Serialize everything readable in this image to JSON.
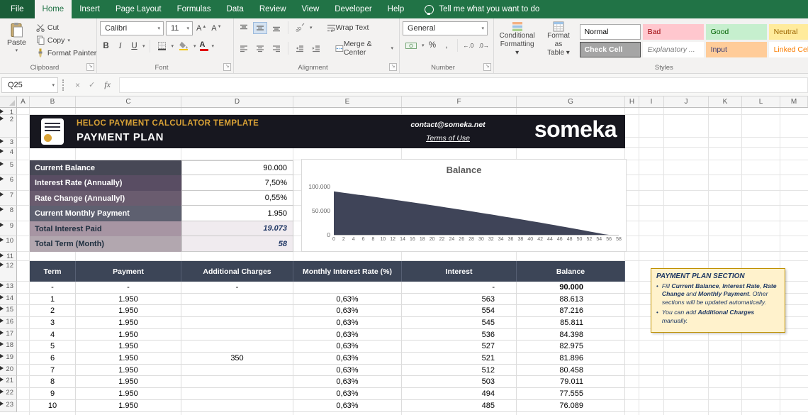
{
  "ribbon": {
    "tabs": [
      {
        "label": "File",
        "active": false
      },
      {
        "label": "Home",
        "active": true
      },
      {
        "label": "Insert",
        "active": false
      },
      {
        "label": "Page Layout",
        "active": false
      },
      {
        "label": "Formulas",
        "active": false
      },
      {
        "label": "Data",
        "active": false
      },
      {
        "label": "Review",
        "active": false
      },
      {
        "label": "View",
        "active": false
      },
      {
        "label": "Developer",
        "active": false
      },
      {
        "label": "Help",
        "active": false
      }
    ],
    "tell_me": "Tell me what you want to do",
    "groups": {
      "clipboard": {
        "label": "Clipboard",
        "paste": "Paste",
        "cut": "Cut",
        "copy": "Copy",
        "format_painter": "Format Painter"
      },
      "font": {
        "label": "Font",
        "family": "Calibri",
        "size": "11",
        "bold": "B",
        "italic": "I",
        "underline": "U"
      },
      "alignment": {
        "label": "Alignment",
        "wrap_text": "Wrap Text",
        "merge_center": "Merge & Center"
      },
      "number": {
        "label": "Number",
        "format": "General"
      },
      "styles": {
        "label": "Styles",
        "conditional_1": "Conditional",
        "conditional_2": "Formatting ▾",
        "format_1": "Format as",
        "format_2": "Table ▾",
        "gallery": [
          {
            "label": "Normal",
            "bg": "#FFFFFF",
            "color": "#000000",
            "border": "#ABABAB"
          },
          {
            "label": "Bad",
            "bg": "#FFC7CE",
            "color": "#9C0006"
          },
          {
            "label": "Good",
            "bg": "#C6EFCE",
            "color": "#006100"
          },
          {
            "label": "Neutral",
            "bg": "#FFEB9C",
            "color": "#9C6500"
          },
          {
            "label": "Check Cell",
            "bg": "#A5A5A5",
            "color": "#FFFFFF",
            "bold": true,
            "border": "#4D4D4D"
          },
          {
            "label": "Explanatory ...",
            "bg": "#FFFFFF",
            "color": "#7F7F7F",
            "italic": true
          },
          {
            "label": "Input",
            "bg": "#FFCC99",
            "color": "#3F3F76"
          },
          {
            "label": "Linked Cell",
            "bg": "#FFFFFF",
            "color": "#FA7D00"
          }
        ]
      }
    }
  },
  "formula_bar": {
    "name_box": "Q25",
    "cancel": "×",
    "enter": "✓",
    "fx": "fx"
  },
  "grid": {
    "col_letters": [
      "A",
      "B",
      "C",
      "D",
      "E",
      "F",
      "G",
      "H",
      "I",
      "J",
      "K",
      "L",
      "M"
    ],
    "row_numbers": [
      1,
      2,
      3,
      4,
      5,
      6,
      7,
      8,
      9,
      10,
      11,
      12,
      13,
      14,
      15,
      16,
      17,
      18,
      19,
      20,
      21,
      22,
      23
    ]
  },
  "banner": {
    "title": "HELOC PAYMENT CALCULATOR TEMPLATE",
    "subtitle": "PAYMENT PLAN",
    "contact": "contact@someka.net",
    "terms": "Terms of Use",
    "logo": "someka"
  },
  "info_table": {
    "rows": [
      {
        "label": "Current Balance",
        "value": "90.000",
        "bg": "#474856"
      },
      {
        "label": "Interest Rate (Annually)",
        "value": "7,50%",
        "bg": "#594D63"
      },
      {
        "label": "Rate Change (Annuallyl)",
        "value": "0,55%",
        "bg": "#6A5C6F"
      },
      {
        "label": "Current Monthly Payment",
        "value": "1.950",
        "bg": "#5E6070"
      },
      {
        "label": "Total Interest Paid",
        "value": "19.073",
        "bg": "#A795A3",
        "text": "#203040",
        "value_bg": "#F0EBEF",
        "value_italic": true
      },
      {
        "label": "Total Term (Month)",
        "value": "58",
        "bg": "#B2A7AF",
        "text": "#203040",
        "value_bg": "#F0EBEF",
        "value_italic": true
      }
    ]
  },
  "payment_table": {
    "headers": [
      "Term",
      "Payment",
      "Additional Charges",
      "Monthly Interest Rate (%)",
      "Interest",
      "Balance"
    ],
    "rows": [
      [
        "-",
        "-",
        "-",
        "",
        "-",
        "90.000"
      ],
      [
        "1",
        "1.950",
        "",
        "0,63%",
        "563",
        "88.613"
      ],
      [
        "2",
        "1.950",
        "",
        "0,63%",
        "554",
        "87.216"
      ],
      [
        "3",
        "1.950",
        "",
        "0,63%",
        "545",
        "85.811"
      ],
      [
        "4",
        "1.950",
        "",
        "0,63%",
        "536",
        "84.398"
      ],
      [
        "5",
        "1.950",
        "",
        "0,63%",
        "527",
        "82.975"
      ],
      [
        "6",
        "1.950",
        "350",
        "0,63%",
        "521",
        "81.896"
      ],
      [
        "7",
        "1.950",
        "",
        "0,63%",
        "512",
        "80.458"
      ],
      [
        "8",
        "1.950",
        "",
        "0,63%",
        "503",
        "79.011"
      ],
      [
        "9",
        "1.950",
        "",
        "0,63%",
        "494",
        "77.555"
      ],
      [
        "10",
        "1.950",
        "",
        "0,63%",
        "485",
        "76.089"
      ]
    ]
  },
  "note": {
    "title": "PAYMENT PLAN SECTION",
    "bullets": [
      [
        {
          "t": "Fill "
        },
        {
          "t": "Current Balance",
          "b": true
        },
        {
          "t": ", "
        },
        {
          "t": "Interest Rate",
          "b": true
        },
        {
          "t": ", "
        },
        {
          "t": "Rate Change",
          "b": true
        },
        {
          "t": " and "
        },
        {
          "t": "Monthly Payment",
          "b": true
        },
        {
          "t": ". Other sections will be updated automatically."
        }
      ],
      [
        {
          "t": "You can add "
        },
        {
          "t": "Additional Charges",
          "b": true
        },
        {
          "t": " manually."
        }
      ]
    ]
  },
  "chart_data": {
    "type": "area",
    "title": "Balance",
    "xlim": [
      0,
      58
    ],
    "ylim": [
      0,
      100000
    ],
    "x_ticks": [
      0,
      2,
      4,
      6,
      8,
      10,
      12,
      14,
      16,
      18,
      20,
      22,
      24,
      26,
      28,
      30,
      32,
      34,
      36,
      38,
      40,
      42,
      44,
      46,
      48,
      50,
      52,
      54,
      56,
      58
    ],
    "y_ticks": [
      {
        "label": "100.000",
        "value": 100000
      },
      {
        "label": "50.000",
        "value": 50000
      },
      {
        "label": "0",
        "value": 0
      }
    ],
    "legend": false,
    "gridlines": false,
    "series": [
      {
        "name": "Balance",
        "color": "#3F4458",
        "start_balance": 90000,
        "annual_interest_rate_pct": 7.5,
        "annual_rate_increase_pct": 0.55,
        "monthly_payment": 1950,
        "additional_charge": 350,
        "additional_charge_month": 6,
        "months": 58,
        "visible_balances": [
          90000,
          88613,
          87216,
          85811,
          84398,
          82975,
          81896,
          80458,
          79011,
          77555,
          76089
        ]
      }
    ]
  }
}
